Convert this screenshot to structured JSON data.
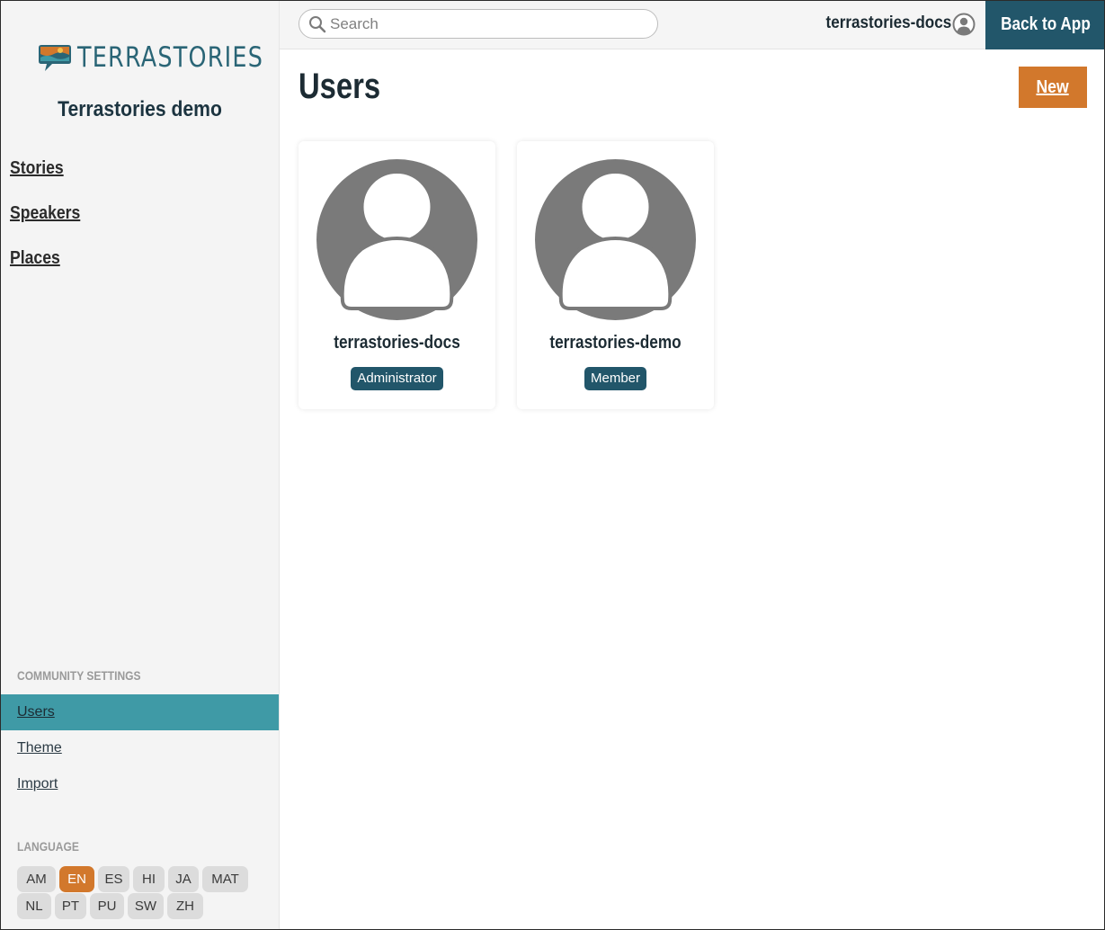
{
  "brand": {
    "logo_text": "TERRASTORIES",
    "community_name": "Terrastories demo",
    "accent": "#d2782c",
    "primary": "#22566a",
    "active_nav_bg": "#3f9aa6"
  },
  "nav": {
    "items": [
      {
        "label": "Stories"
      },
      {
        "label": "Speakers"
      },
      {
        "label": "Places"
      }
    ]
  },
  "community_settings": {
    "heading": "COMMUNITY SETTINGS",
    "items": [
      {
        "label": "Users",
        "active": true
      },
      {
        "label": "Theme",
        "active": false
      },
      {
        "label": "Import",
        "active": false
      }
    ]
  },
  "language": {
    "heading": "LANGUAGE",
    "options": [
      "AM",
      "EN",
      "ES",
      "HI",
      "JA",
      "MAT",
      "NL",
      "PT",
      "PU",
      "SW",
      "ZH"
    ],
    "selected": "EN"
  },
  "topbar": {
    "search_placeholder": "Search",
    "search_value": "",
    "current_user": "terrastories-docs",
    "back_label": "Back to App"
  },
  "page": {
    "title": "Users",
    "new_label": "New"
  },
  "users": [
    {
      "name": "terrastories-docs",
      "role": "Administrator",
      "avatar_icon": "user-avatar-icon"
    },
    {
      "name": "terrastories-demo",
      "role": "Member",
      "avatar_icon": "user-avatar-icon"
    }
  ]
}
